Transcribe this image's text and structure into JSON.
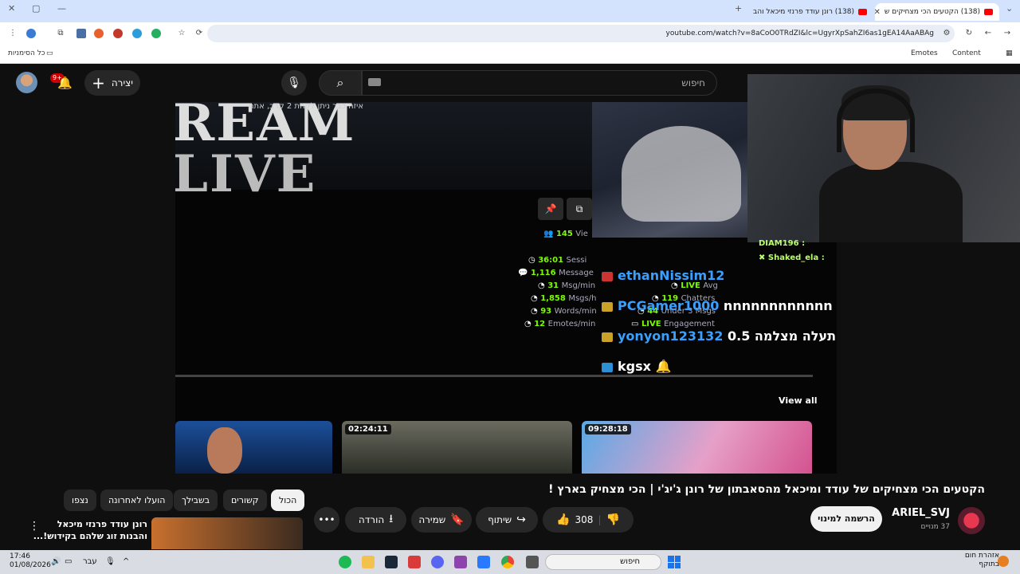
{
  "browser": {
    "tabs": [
      {
        "title": "(138) הקטעים הכי מצחיקים ש",
        "active": true
      },
      {
        "title": "(138) רונן עודד פרנזי מיכאל והב",
        "active": false
      }
    ],
    "url": "youtube.com/watch?v=8aCoO0TRdZI&lc=UgyrXpSahZI6as1gEA14AaABAg",
    "bookmarks": {
      "all_bookmarks": "כל הסימניות",
      "emotes": "Emotes",
      "content": "Content"
    }
  },
  "header": {
    "search_placeholder": "חיפוש",
    "create_label": "יצירה",
    "notification_badge": "9+"
  },
  "player": {
    "banner_big": "REAM",
    "banner_big2": "LIVE",
    "banner_hebrew": "איזה כבר ניתן לקחת 2 קרב, אתה",
    "stats": {
      "viewers": "145",
      "viewers_label": "Vie",
      "session": "36:01",
      "session_label": "Sessi",
      "messages": "1,116",
      "messages_label": "Message",
      "msg_min": "31",
      "msg_min_label": "Msg/min",
      "msgs_h": "1,858",
      "msgs_h_label": "Msgs/h",
      "words_min": "93",
      "words_min_label": "Words/min",
      "emotes_min": "12",
      "emotes_min_label": "Emotes/min",
      "live_avg": "LIVE",
      "live_avg_label": "Avg",
      "chatters": "119",
      "chatters_label": "Chatters",
      "under": "44",
      "under_label": "Under 3 Msgs",
      "engagement": "LIVE",
      "engagement_label": "Engagement"
    },
    "chat": [
      {
        "user": "ethanNissim12",
        "text": ""
      },
      {
        "user": "PCGamer1000",
        "text": "nnnnnnnnnnnn"
      },
      {
        "user": "yonyon123132",
        "text": "תעלה מצלמה 0.5"
      },
      {
        "user": "kgsx",
        "text": ""
      }
    ],
    "webcam_chat": [
      {
        "user": "DIAM196",
        "text": ":"
      },
      {
        "user": "Shaked_ela",
        "text": ":"
      }
    ],
    "view_all": "View all",
    "thumb_durations": [
      "02:24:11",
      "09:28:18"
    ]
  },
  "video": {
    "title": "הקטעים הכי מצחיקים של עודד ומיכאל מהסאבתון של רונן ג'יג'י | הכי מצחיק בארץ !",
    "channel": "ARIEL_SVJ",
    "subscribers": "37 מנויים",
    "subscribe_label": "הרשמה למינוי",
    "like_count": "308",
    "share_label": "שיתוף",
    "save_label": "שמירה",
    "download_label": "הורדה"
  },
  "filters": [
    "הכול",
    "קשורים",
    "בשבילך",
    "הועלו לאחרונה",
    "נצפו"
  ],
  "recommendation": {
    "title": "רונן עודד פרנזי מיכאל והבנות זוג שלהם בקידוש!..."
  },
  "taskbar": {
    "search_placeholder": "חיפוש",
    "time": "17:46",
    "date": "01/08/2026",
    "lang": "עבר",
    "weather_line1": "אזהרת חום",
    "weather_line2": "בתוקף"
  },
  "colors": {
    "yt_red": "#ff0000",
    "stat_green": "#7CFC00",
    "chat_blue": "#3aa0ff"
  }
}
